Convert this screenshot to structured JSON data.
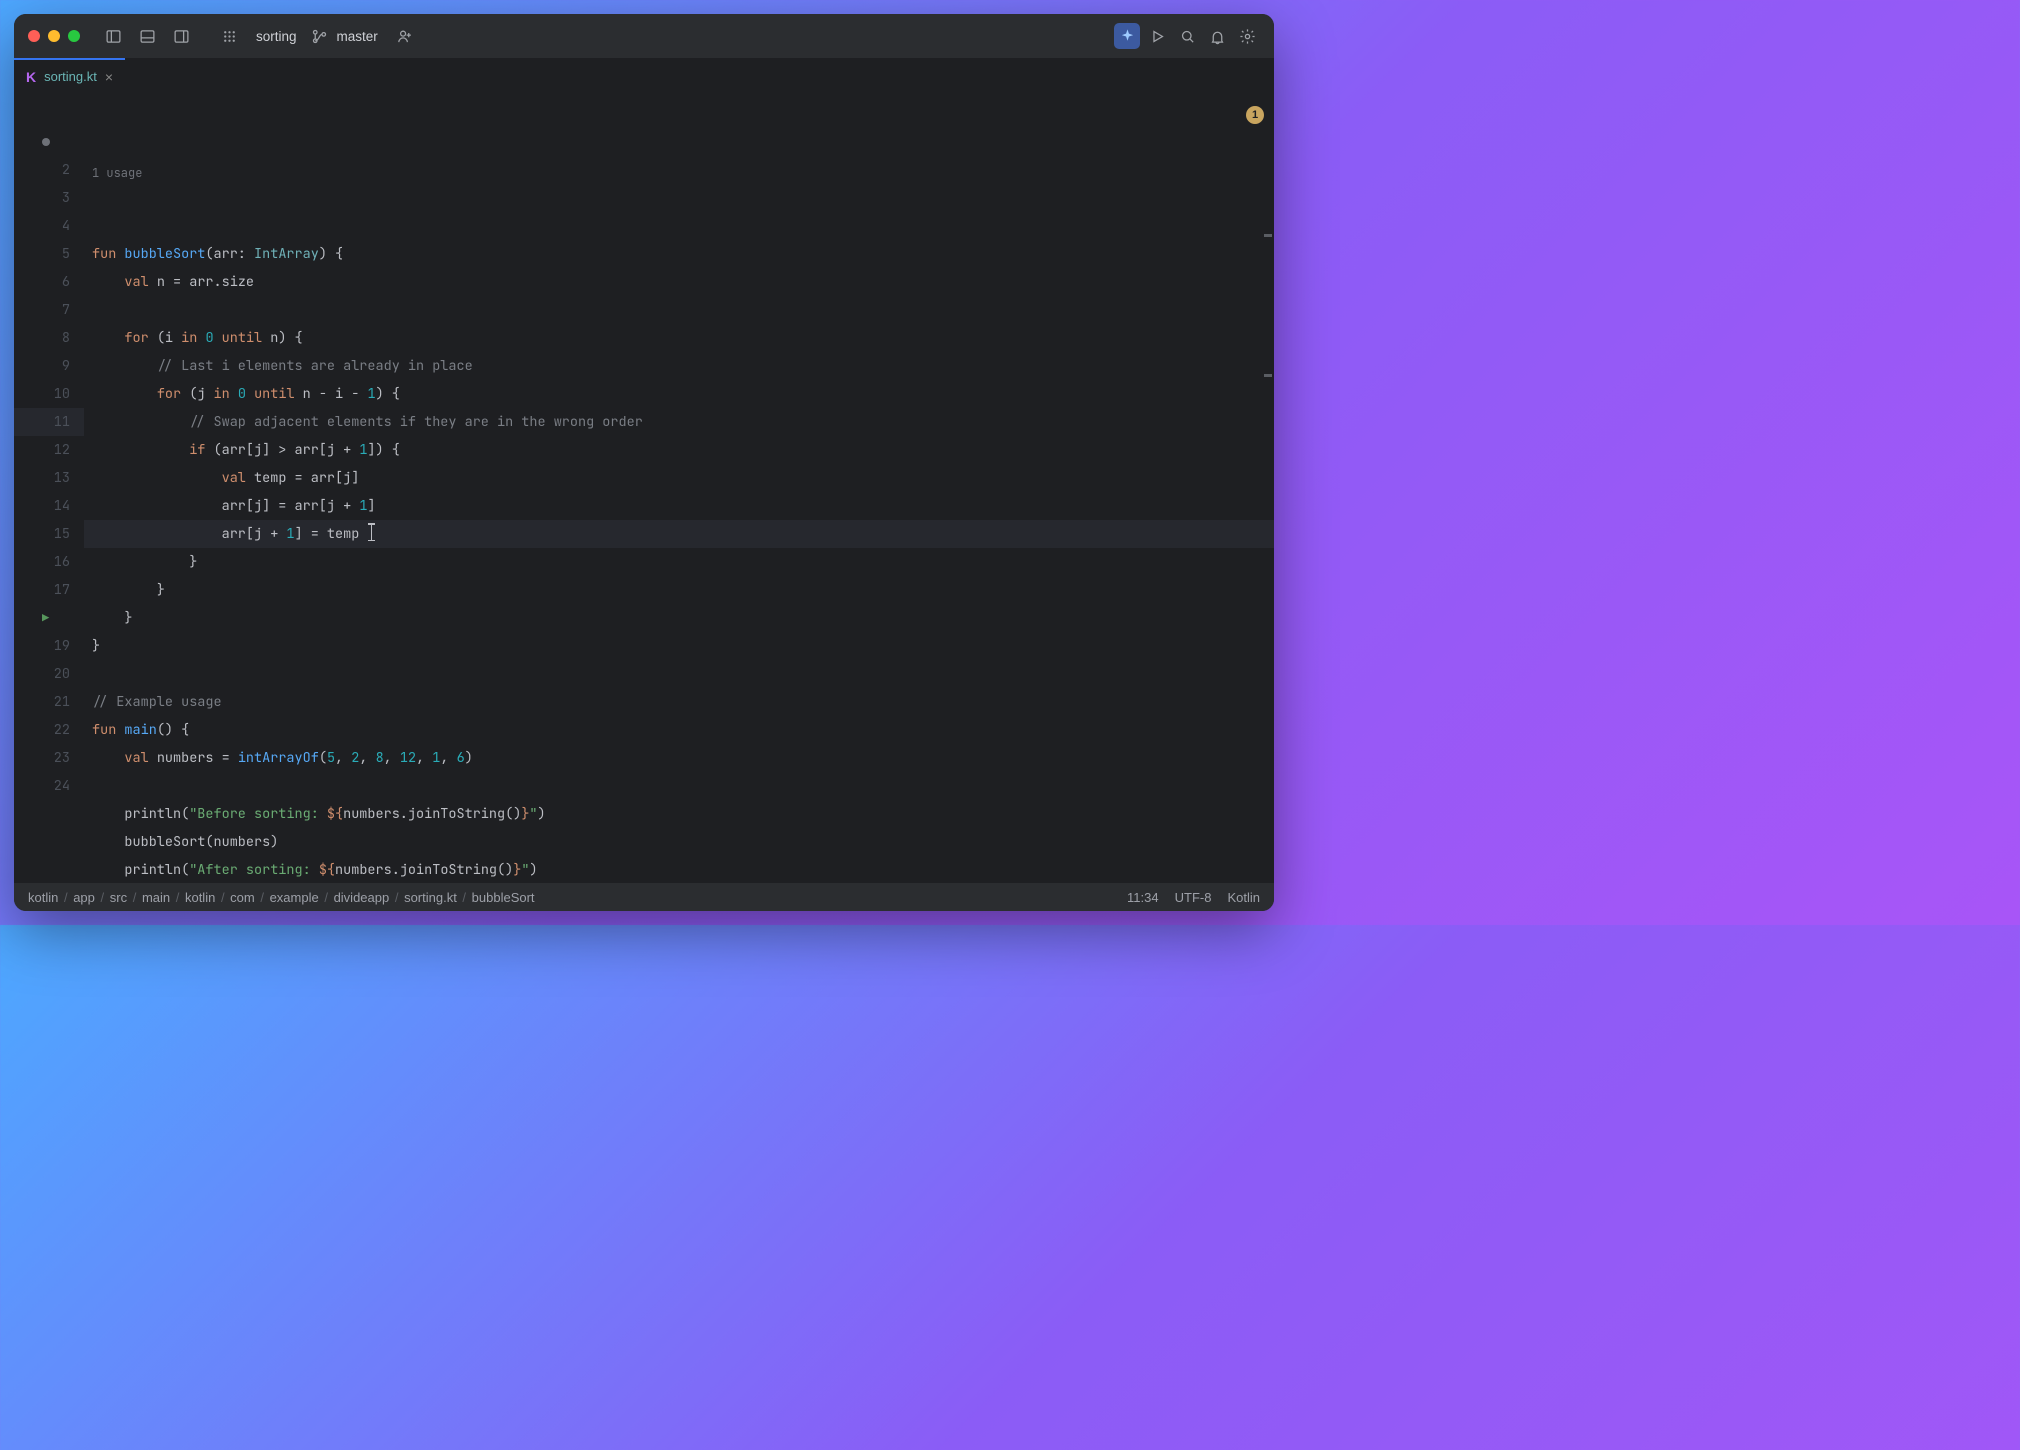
{
  "titlebar": {
    "project": "sorting",
    "branch": "master"
  },
  "tab": {
    "filename": "sorting.kt"
  },
  "editor": {
    "usage_hint": "1 usage",
    "problems_count": "1",
    "cursor_line": 11,
    "lines": [
      {
        "n": "●",
        "tokens": [
          [
            "kw",
            "fun "
          ],
          [
            "fn",
            "bubbleSort"
          ],
          [
            "op",
            "(arr: "
          ],
          [
            "typ",
            "IntArray"
          ],
          [
            "op",
            ") {"
          ]
        ]
      },
      {
        "n": "2",
        "tokens": [
          [
            "op",
            "    "
          ],
          [
            "kw",
            "val"
          ],
          [
            "op",
            " n = arr.size"
          ]
        ]
      },
      {
        "n": "3",
        "tokens": []
      },
      {
        "n": "4",
        "tokens": [
          [
            "op",
            "    "
          ],
          [
            "kw",
            "for"
          ],
          [
            "op",
            " (i "
          ],
          [
            "kw",
            "in"
          ],
          [
            "op",
            " "
          ],
          [
            "num",
            "0"
          ],
          [
            "op",
            " "
          ],
          [
            "kw",
            "until"
          ],
          [
            "op",
            " n) {"
          ]
        ]
      },
      {
        "n": "5",
        "tokens": [
          [
            "op",
            "        "
          ],
          [
            "cmt",
            "// Last i elements are already in place"
          ]
        ]
      },
      {
        "n": "6",
        "tokens": [
          [
            "op",
            "        "
          ],
          [
            "kw",
            "for"
          ],
          [
            "op",
            " (j "
          ],
          [
            "kw",
            "in"
          ],
          [
            "op",
            " "
          ],
          [
            "num",
            "0"
          ],
          [
            "op",
            " "
          ],
          [
            "kw",
            "until"
          ],
          [
            "op",
            " n - i - "
          ],
          [
            "num",
            "1"
          ],
          [
            "op",
            ") {"
          ]
        ]
      },
      {
        "n": "7",
        "tokens": [
          [
            "op",
            "            "
          ],
          [
            "cmt",
            "// Swap adjacent elements if they are in the wrong order"
          ]
        ]
      },
      {
        "n": "8",
        "tokens": [
          [
            "op",
            "            "
          ],
          [
            "kw",
            "if"
          ],
          [
            "op",
            " (arr[j] > arr[j + "
          ],
          [
            "num",
            "1"
          ],
          [
            "op",
            "]) {"
          ]
        ]
      },
      {
        "n": "9",
        "tokens": [
          [
            "op",
            "                "
          ],
          [
            "kw",
            "val"
          ],
          [
            "op",
            " temp = arr[j]"
          ]
        ]
      },
      {
        "n": "10",
        "tokens": [
          [
            "op",
            "                arr[j] = arr[j + "
          ],
          [
            "num",
            "1"
          ],
          [
            "op",
            "]"
          ]
        ]
      },
      {
        "n": "11",
        "tokens": [
          [
            "op",
            "                arr[j + "
          ],
          [
            "num",
            "1"
          ],
          [
            "op",
            "] = temp"
          ]
        ],
        "hl": true,
        "caret_after": true
      },
      {
        "n": "12",
        "tokens": [
          [
            "op",
            "            }"
          ]
        ]
      },
      {
        "n": "13",
        "tokens": [
          [
            "op",
            "        }"
          ]
        ]
      },
      {
        "n": "14",
        "tokens": [
          [
            "op",
            "    }"
          ]
        ]
      },
      {
        "n": "15",
        "tokens": [
          [
            "op",
            "}"
          ]
        ]
      },
      {
        "n": "16",
        "tokens": []
      },
      {
        "n": "17",
        "tokens": [
          [
            "cmt",
            "// Example usage"
          ]
        ]
      },
      {
        "n": "▶",
        "tokens": [
          [
            "kw",
            "fun "
          ],
          [
            "fn",
            "main"
          ],
          [
            "op",
            "() {"
          ]
        ]
      },
      {
        "n": "19",
        "tokens": [
          [
            "op",
            "    "
          ],
          [
            "kw",
            "val"
          ],
          [
            "op",
            " numbers = "
          ],
          [
            "fn",
            "intArrayOf"
          ],
          [
            "op",
            "("
          ],
          [
            "num",
            "5"
          ],
          [
            "op",
            ", "
          ],
          [
            "num",
            "2"
          ],
          [
            "op",
            ", "
          ],
          [
            "num",
            "8"
          ],
          [
            "op",
            ", "
          ],
          [
            "num",
            "12"
          ],
          [
            "op",
            ", "
          ],
          [
            "num",
            "1"
          ],
          [
            "op",
            ", "
          ],
          [
            "num",
            "6"
          ],
          [
            "op",
            ")"
          ]
        ]
      },
      {
        "n": "20",
        "tokens": []
      },
      {
        "n": "21",
        "tokens": [
          [
            "op",
            "    println("
          ],
          [
            "str",
            "\"Before sorting: "
          ],
          [
            "tmpl",
            "${"
          ],
          [
            "op",
            "numbers.joinToString()"
          ],
          [
            "tmpl",
            "}"
          ],
          [
            "str",
            "\""
          ],
          [
            "op",
            ")"
          ]
        ]
      },
      {
        "n": "22",
        "tokens": [
          [
            "op",
            "    bubbleSort(numbers)"
          ]
        ]
      },
      {
        "n": "23",
        "tokens": [
          [
            "op",
            "    println("
          ],
          [
            "str",
            "\"After sorting: "
          ],
          [
            "tmpl",
            "${"
          ],
          [
            "op",
            "numbers.joinToString()"
          ],
          [
            "tmpl",
            "}"
          ],
          [
            "str",
            "\""
          ],
          [
            "op",
            ")"
          ]
        ]
      },
      {
        "n": "24",
        "tokens": [
          [
            "op",
            "}"
          ]
        ]
      }
    ]
  },
  "breadcrumbs": [
    "kotlin",
    "app",
    "src",
    "main",
    "kotlin",
    "com",
    "example",
    "divideapp",
    "sorting.kt",
    "bubbleSort"
  ],
  "statusbar": {
    "cursor": "11:34",
    "encoding": "UTF-8",
    "language": "Kotlin"
  }
}
